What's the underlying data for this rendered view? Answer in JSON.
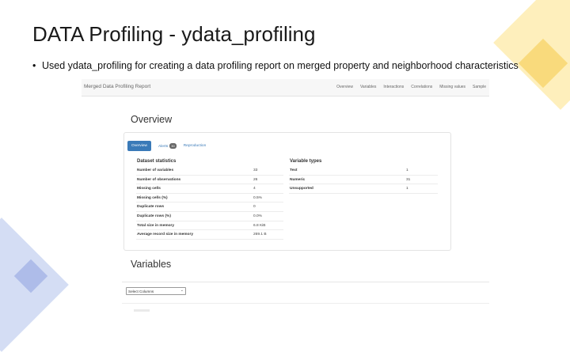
{
  "slide": {
    "title": "DATA Profiling - ydata_profiling",
    "bullet": "Used ydata_profiling for creating a data profiling report on merged property and neighborhood characteristics"
  },
  "report": {
    "brand": "Merged Data Profiling Report",
    "nav": [
      "Overview",
      "Variables",
      "Interactions",
      "Correlations",
      "Missing values",
      "Sample"
    ],
    "overview_title": "Overview",
    "tabs": {
      "overview": "Overview",
      "alerts": "Alerts",
      "alerts_count": "30",
      "reproduction": "Reproduction"
    },
    "dataset_statistics": {
      "heading": "Dataset statistics",
      "rows": [
        {
          "label": "Number of variables",
          "value": "33"
        },
        {
          "label": "Number of observations",
          "value": "26"
        },
        {
          "label": "Missing cells",
          "value": "4"
        },
        {
          "label": "Missing cells (%)",
          "value": "0.5%"
        },
        {
          "label": "Duplicate rows",
          "value": "0"
        },
        {
          "label": "Duplicate rows (%)",
          "value": "0.0%"
        },
        {
          "label": "Total size in memory",
          "value": "6.8 KiB"
        },
        {
          "label": "Average record size in memory",
          "value": "269.1 B"
        }
      ]
    },
    "variable_types": {
      "heading": "Variable types",
      "rows": [
        {
          "label": "Text",
          "value": "1"
        },
        {
          "label": "Numeric",
          "value": "31"
        },
        {
          "label": "Unsupported",
          "value": "1"
        }
      ]
    },
    "variables_title": "Variables",
    "select_label": "Select Columns"
  },
  "colors": {
    "accent": "#3a7ab8",
    "deco_yellow": "#f8d46b",
    "deco_blue": "#a7b6e6"
  }
}
